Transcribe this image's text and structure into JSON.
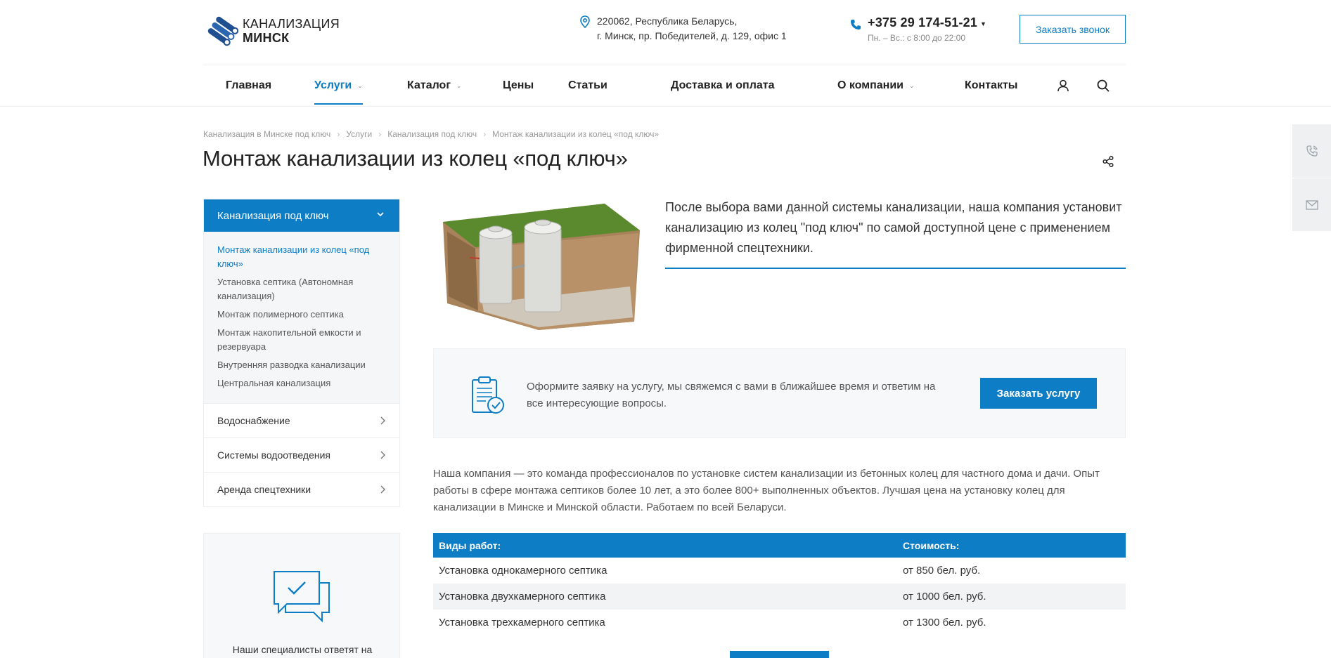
{
  "header": {
    "logo_line1": "КАНАЛИЗАЦИЯ",
    "logo_line2": "МИНСК",
    "address_line1": "220062, Республика Беларусь,",
    "address_line2": "г. Минск, пр. Победителей, д. 129, офис 1",
    "phone": "+375 29 174-51-21",
    "hours": "Пн. – Вс.: с 8:00 до 22:00",
    "callback_label": "Заказать звонок"
  },
  "nav": {
    "items": [
      {
        "label": "Главная"
      },
      {
        "label": "Услуги"
      },
      {
        "label": "Каталог"
      },
      {
        "label": "Цены"
      },
      {
        "label": "Статьи"
      },
      {
        "label": "Доставка и оплата"
      },
      {
        "label": "О компании"
      },
      {
        "label": "Контакты"
      }
    ],
    "active": "Услуги"
  },
  "breadcrumb": [
    "Канализация в Минске под ключ",
    "Услуги",
    "Канализация под ключ",
    "Монтаж канализации из колец «под ключ»"
  ],
  "page_title": "Монтаж канализации из колец «под ключ»",
  "sidebar": {
    "head": "Канализация под ключ",
    "sub_items": [
      {
        "label": "Монтаж канализации из колец «под ключ»",
        "active": true
      },
      {
        "label": "Установка септика (Автономная канализация)"
      },
      {
        "label": "Монтаж полимерного септика"
      },
      {
        "label": "Монтаж накопительной емкости и резервуара"
      },
      {
        "label": "Внутренняя разводка канализации"
      },
      {
        "label": "Центральная канализация"
      }
    ],
    "rows": [
      {
        "label": "Водоснабжение"
      },
      {
        "label": "Системы водоотведения"
      },
      {
        "label": "Аренда спецтехники"
      }
    ]
  },
  "help_box": {
    "text": "Наши специалисты ответят на"
  },
  "intro": "После выбора вами данной системы канализации, наша компания установит канализацию из колец \"под ключ\" по самой доступной цене с применением фирменной спецтехники.",
  "order_box": {
    "text": "Оформите заявку на услугу, мы свяжемся с вами в ближайшее время и ответим на все интересующие вопросы.",
    "button": "Заказать услугу"
  },
  "body_text": "Наша компания — это команда профессионалов по установке систем канализации из бетонных колец для частного дома и дачи. Опыт работы в сфере монтажа септиков более 10 лет, а это более 800+ выполненных объектов. Лучшая цена на установку колец для канализации в Минске и Минской области. Работаем по всей Беларуси.",
  "price_table": {
    "headers": [
      "Виды работ:",
      "Стоимость:"
    ],
    "rows": [
      [
        "Установка однокамерного септика",
        "от 850 бел. руб."
      ],
      [
        "Установка двухкамерного септика",
        "от 1000 бел. руб."
      ],
      [
        "Установка трехкамерного септика",
        "от 1300 бел. руб."
      ]
    ]
  },
  "colors": {
    "accent": "#0d7dc6",
    "panel": "#f7f8f9"
  },
  "icons": [
    "logo-pipes-icon",
    "location-pin-icon",
    "phone-icon",
    "user-icon",
    "search-icon",
    "share-icon",
    "phone-call-icon",
    "mail-icon",
    "clipboard-check-icon",
    "chat-check-icon",
    "chevron-down-icon",
    "chevron-right-icon"
  ]
}
